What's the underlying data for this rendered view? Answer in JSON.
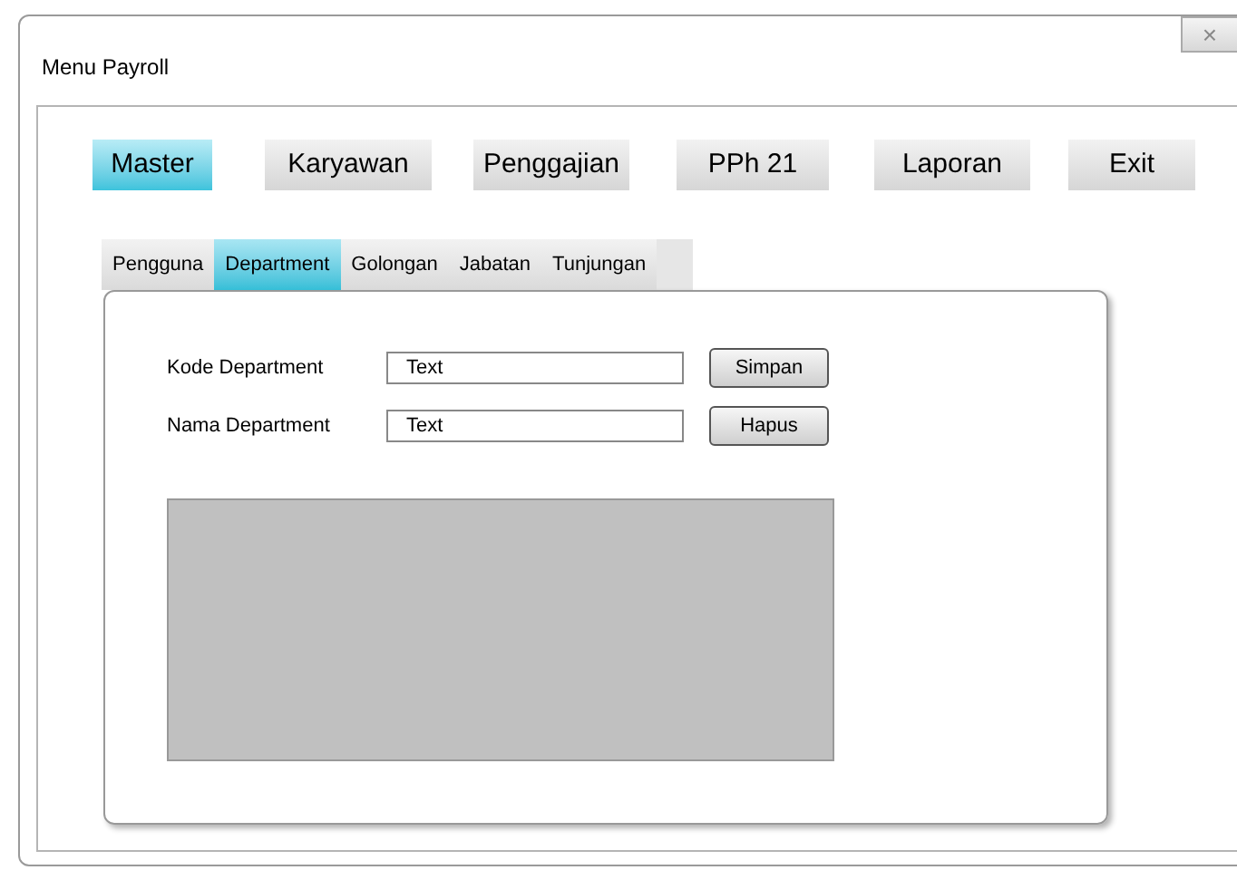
{
  "window": {
    "title": "Menu Payroll",
    "close": "×"
  },
  "menu": [
    {
      "label": "Master",
      "selected": true
    },
    {
      "label": "Karyawan",
      "selected": false
    },
    {
      "label": "Penggajian",
      "selected": false
    },
    {
      "label": "PPh 21",
      "selected": false
    },
    {
      "label": "Laporan",
      "selected": false
    },
    {
      "label": "Exit",
      "selected": false
    }
  ],
  "tabs": [
    {
      "label": "Pengguna",
      "selected": false
    },
    {
      "label": "Department",
      "selected": true
    },
    {
      "label": "Golongan",
      "selected": false
    },
    {
      "label": "Jabatan",
      "selected": false
    },
    {
      "label": "Tunjungan",
      "selected": false
    }
  ],
  "form": [
    {
      "label": "Kode Department",
      "value": "Text",
      "button": "Simpan"
    },
    {
      "label": "Nama Department",
      "value": "Text",
      "button": "Hapus"
    }
  ]
}
